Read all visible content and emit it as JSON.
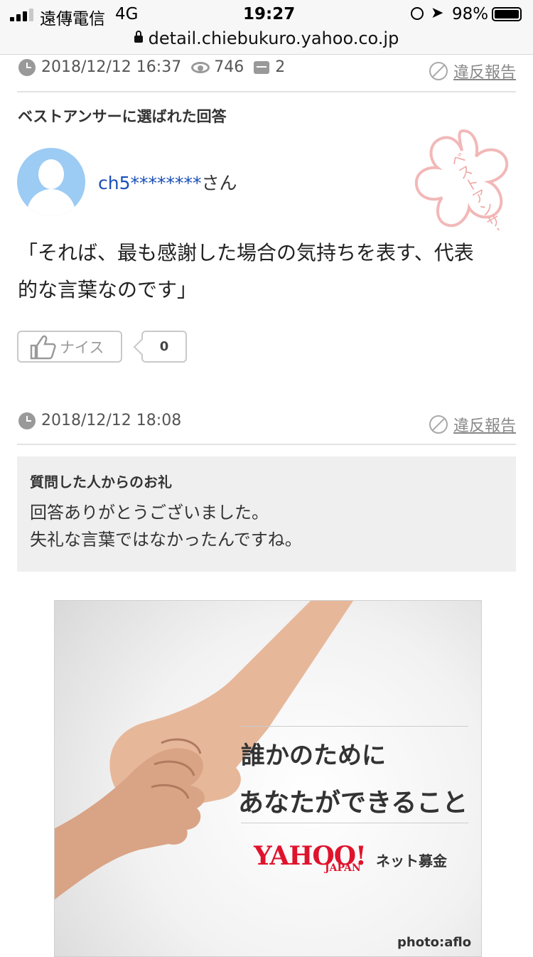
{
  "status_bar": {
    "carrier": "遠傳電信",
    "network": "4G",
    "time": "19:27",
    "battery": "98%"
  },
  "browser": {
    "url": "detail.chiebukuro.yahoo.co.jp"
  },
  "question_meta": {
    "date": "2018/12/12 16:37",
    "views": "746",
    "comments": "2",
    "report_label": "違反報告"
  },
  "best_answer": {
    "heading": "ベストアンサーに選ばれた回答",
    "username": "ch5********",
    "username_suffix": "さん",
    "stamp_text": "ベストアンサー",
    "body_line1": "「それば、最も感謝した場合の気持ちを表す、代表",
    "body_line2": "的な言葉なのです」",
    "nice_label": "ナイス",
    "nice_count": "0"
  },
  "answer_meta": {
    "date": "2018/12/12 18:08",
    "report_label": "違反報告"
  },
  "thanks": {
    "title": "質問した人からのお礼",
    "line1": "回答ありがとうございました。",
    "line2": "失礼な言葉ではなかったんですね。"
  },
  "ad": {
    "line1": "誰かのために",
    "line2": "あなたができること",
    "logo": "YAHOO!",
    "logo_sub": "JAPAN",
    "service": "ネット募金",
    "credit": "photo:aflo"
  },
  "colors": {
    "link_blue": "#1a4fb8",
    "avatar_bg": "#9ccbf4",
    "stamp_pink": "#f2b8b8",
    "yahoo_red": "#e0132c"
  }
}
